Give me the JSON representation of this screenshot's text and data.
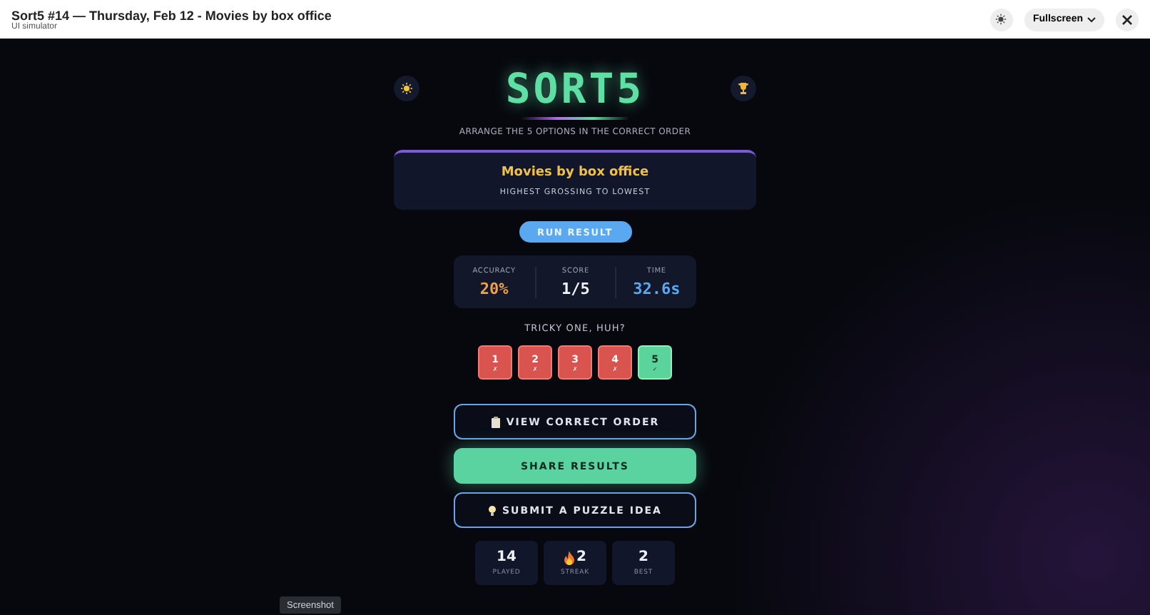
{
  "window": {
    "title": "Sort5 #14 — Thursday, Feb 12 - Movies by box office",
    "subtitle": "UI simulator",
    "fullscreen_label": "Fullscreen"
  },
  "game": {
    "logo": "SORT5",
    "tagline": "ARRANGE THE 5 OPTIONS IN THE CORRECT ORDER",
    "puzzle": {
      "title": "Movies by box office",
      "subtitle": "HIGHEST GROSSING TO LOWEST"
    },
    "run_button": "RUN RESULT",
    "stats": [
      {
        "label": "ACCURACY",
        "value": "20%",
        "kind": "accuracy"
      },
      {
        "label": "SCORE",
        "value": "1/5",
        "kind": "score"
      },
      {
        "label": "TIME",
        "value": "32.6s",
        "kind": "time"
      }
    ],
    "message": "TRICKY ONE, HUH?",
    "tiles": [
      {
        "number": "1",
        "mark": "✗",
        "correct": false
      },
      {
        "number": "2",
        "mark": "✗",
        "correct": false
      },
      {
        "number": "3",
        "mark": "✗",
        "correct": false
      },
      {
        "number": "4",
        "mark": "✗",
        "correct": false
      },
      {
        "number": "5",
        "mark": "✓",
        "correct": true
      }
    ],
    "actions": [
      {
        "label": "VIEW CORRECT ORDER",
        "kind": "clipboard"
      },
      {
        "label": "SHARE RESULTS",
        "kind": "primary"
      },
      {
        "label": "SUBMIT A PUZZLE IDEA",
        "kind": "bulb"
      }
    ],
    "totals": [
      {
        "value": "14",
        "label": "PLAYED",
        "kind": "plain"
      },
      {
        "value": "2",
        "label": "STREAK",
        "kind": "flame"
      },
      {
        "value": "2",
        "label": "BEST",
        "kind": "plain"
      }
    ]
  },
  "screenshot_button": "Screenshot"
}
